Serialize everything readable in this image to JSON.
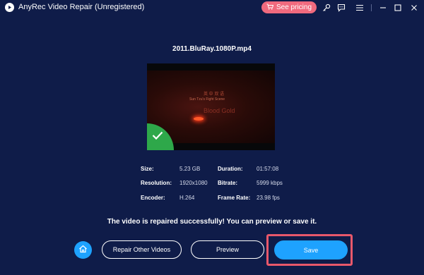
{
  "window": {
    "title": "AnyRec Video Repair (Unregistered)",
    "pricing_label": "See pricing",
    "icons": [
      "key-icon",
      "feedback-icon",
      "menu-icon",
      "minimize-icon",
      "maximize-icon",
      "close-icon"
    ]
  },
  "file": {
    "name": "2011.BluRay.1080P.mp4"
  },
  "preview": {
    "text_line1": "英 中 双 语",
    "text_line2": "Sun Tzu's Fight Scene",
    "text_line3": "Blood Gold"
  },
  "info": {
    "size_label": "Size:",
    "size_value": "5.23 GB",
    "duration_label": "Duration:",
    "duration_value": "01:57:08",
    "resolution_label": "Resolution:",
    "resolution_value": "1920x1080",
    "bitrate_label": "Bitrate:",
    "bitrate_value": "5999 kbps",
    "encoder_label": "Encoder:",
    "encoder_value": "H.264",
    "framerate_label": "Frame Rate:",
    "framerate_value": "23.98 fps"
  },
  "status": {
    "message": "The video is repaired successfully! You can preview or save it."
  },
  "actions": {
    "repair_other_label": "Repair Other Videos",
    "preview_label": "Preview",
    "save_label": "Save"
  },
  "colors": {
    "background": "#0f1c49",
    "accent": "#1ea2ff",
    "pricing": "#f06a7e",
    "success": "#2ea84a",
    "highlight": "#e8586b"
  }
}
